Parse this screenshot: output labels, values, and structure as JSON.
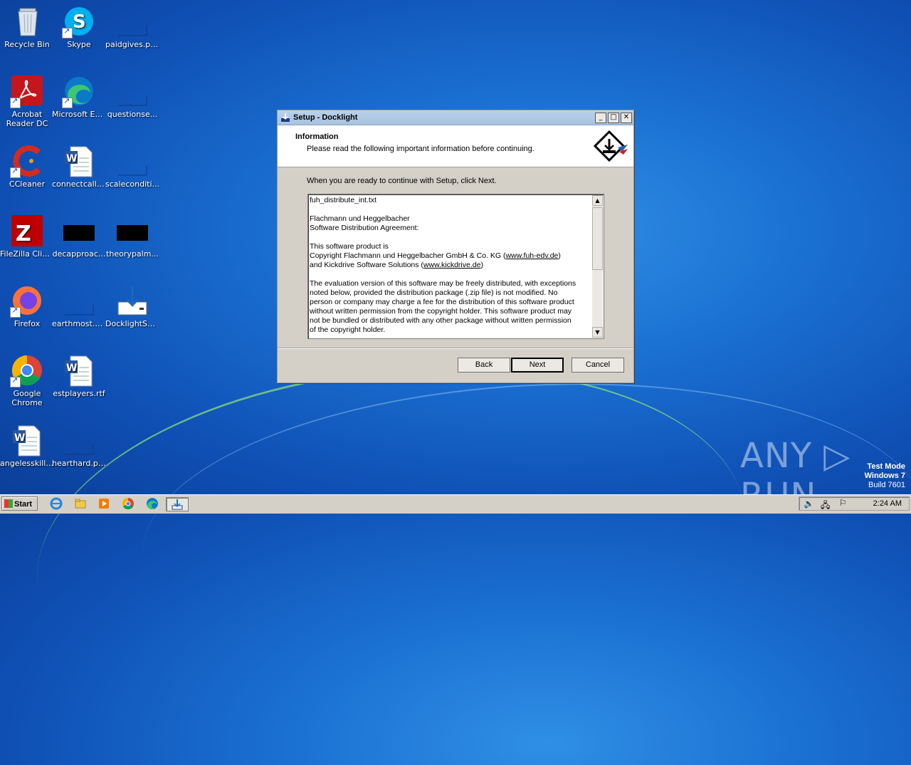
{
  "desktop": {
    "icons": [
      {
        "label": "Recycle Bin"
      },
      {
        "label": "Skype"
      },
      {
        "label": "paidgives.png"
      },
      {
        "label": "Acrobat Reader DC"
      },
      {
        "label": "Microsoft Edge"
      },
      {
        "label": "questionse..."
      },
      {
        "label": "CCleaner"
      },
      {
        "label": "connectcall.rtf"
      },
      {
        "label": "scaleconditi..."
      },
      {
        "label": "FileZilla Client"
      },
      {
        "label": "decapproac..."
      },
      {
        "label": "theorypalm..."
      },
      {
        "label": "Firefox"
      },
      {
        "label": "earthmost.png"
      },
      {
        "label": "DocklightSet..."
      },
      {
        "label": "Google Chrome"
      },
      {
        "label": "estplayers.rtf"
      },
      {
        "label": "angelesskills..."
      },
      {
        "label": "hearthard.png"
      }
    ]
  },
  "dialog": {
    "title": "Setup - Docklight",
    "header_title": "Information",
    "header_subtitle": "Please read the following important information before continuing.",
    "prompt": "When you are ready to continue with Setup, click Next.",
    "memo": {
      "line1": "fuh_distribute_int.txt",
      "line2": "Flachmann und Heggelbacher",
      "line3": "Software Distribution Agreement:",
      "line4": "This software product is",
      "line5a": "Copyright Flachmann und Heggelbacher GmbH & Co. KG (",
      "link1": "www.fuh-edv.de",
      "line5b": ")",
      "line6a": "and Kickdrive Software Solutions (",
      "link2": "www.kickdrive.de",
      "line6b": ")",
      "para": [
        "The evaluation version of this software may be freely distributed, with exceptions",
        "noted below, provided the distribution package (.zip file) is not modified. No",
        "person or company may charge a fee for the distribution of this software product",
        "without written permission from the copyright holder. This software product may",
        "not be bundled or distributed with any other package without written permission",
        "of the copyright holder."
      ]
    },
    "buttons": {
      "back": "Back",
      "next": "Next",
      "cancel": "Cancel"
    },
    "title_buttons": {
      "minimize": "_",
      "maximize": "□",
      "close": "✕"
    }
  },
  "taskbar": {
    "start_label": "Start",
    "clock": "2:24 AM"
  },
  "watermark": {
    "line1": "Test Mode",
    "line2": "Windows 7",
    "line3": "Build 7601",
    "brand": "ANY ▷ RUN"
  }
}
